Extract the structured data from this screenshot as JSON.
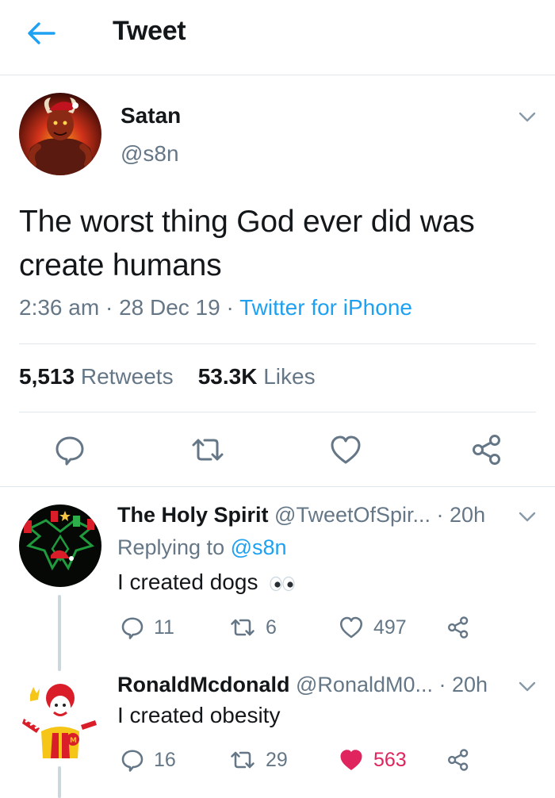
{
  "header": {
    "title": "Tweet",
    "back_icon": "arrow-left-icon"
  },
  "colors": {
    "accent": "#1da1f2",
    "secondary_text": "#657786",
    "like_active": "#e0245e",
    "divider": "#e1e8ed"
  },
  "main_tweet": {
    "display_name": "Satan",
    "handle": "@s8n",
    "text": "The worst thing God ever did was create humans",
    "time": "2:36 am",
    "date": "28 Dec 19",
    "source": "Twitter for iPhone",
    "separator": "·",
    "retweets_count": "5,513",
    "retweets_label": "Retweets",
    "likes_count": "53.3K",
    "likes_label": "Likes",
    "actions": [
      "reply-icon",
      "retweet-icon",
      "like-icon",
      "share-icon"
    ]
  },
  "replies": [
    {
      "display_name": "The Holy Spirit",
      "handle": "@TweetOfSpir...",
      "time": "· 20h",
      "replying_label": "Replying to",
      "replying_handle": "@s8n",
      "text": "I created dogs",
      "emoji": "eyes-icon",
      "reply_count": "11",
      "retweet_count": "6",
      "like_count": "497",
      "liked": false
    },
    {
      "display_name": "RonaldMcdonald",
      "handle": "@RonaldM0...",
      "time": "· 20h",
      "text": "I created obesity",
      "reply_count": "16",
      "retweet_count": "29",
      "like_count": "563",
      "liked": true
    }
  ]
}
